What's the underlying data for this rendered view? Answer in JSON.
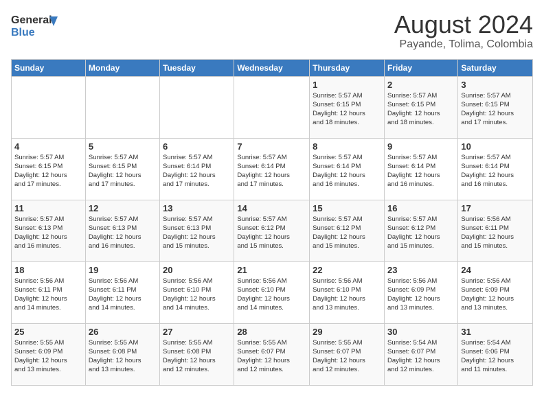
{
  "header": {
    "logo_line1": "General",
    "logo_line2": "Blue",
    "main_title": "August 2024",
    "subtitle": "Payande, Tolima, Colombia"
  },
  "days_of_week": [
    "Sunday",
    "Monday",
    "Tuesday",
    "Wednesday",
    "Thursday",
    "Friday",
    "Saturday"
  ],
  "weeks": [
    [
      {
        "day": "",
        "info": ""
      },
      {
        "day": "",
        "info": ""
      },
      {
        "day": "",
        "info": ""
      },
      {
        "day": "",
        "info": ""
      },
      {
        "day": "1",
        "info": "Sunrise: 5:57 AM\nSunset: 6:15 PM\nDaylight: 12 hours\nand 18 minutes."
      },
      {
        "day": "2",
        "info": "Sunrise: 5:57 AM\nSunset: 6:15 PM\nDaylight: 12 hours\nand 18 minutes."
      },
      {
        "day": "3",
        "info": "Sunrise: 5:57 AM\nSunset: 6:15 PM\nDaylight: 12 hours\nand 17 minutes."
      }
    ],
    [
      {
        "day": "4",
        "info": "Sunrise: 5:57 AM\nSunset: 6:15 PM\nDaylight: 12 hours\nand 17 minutes."
      },
      {
        "day": "5",
        "info": "Sunrise: 5:57 AM\nSunset: 6:15 PM\nDaylight: 12 hours\nand 17 minutes."
      },
      {
        "day": "6",
        "info": "Sunrise: 5:57 AM\nSunset: 6:14 PM\nDaylight: 12 hours\nand 17 minutes."
      },
      {
        "day": "7",
        "info": "Sunrise: 5:57 AM\nSunset: 6:14 PM\nDaylight: 12 hours\nand 17 minutes."
      },
      {
        "day": "8",
        "info": "Sunrise: 5:57 AM\nSunset: 6:14 PM\nDaylight: 12 hours\nand 16 minutes."
      },
      {
        "day": "9",
        "info": "Sunrise: 5:57 AM\nSunset: 6:14 PM\nDaylight: 12 hours\nand 16 minutes."
      },
      {
        "day": "10",
        "info": "Sunrise: 5:57 AM\nSunset: 6:14 PM\nDaylight: 12 hours\nand 16 minutes."
      }
    ],
    [
      {
        "day": "11",
        "info": "Sunrise: 5:57 AM\nSunset: 6:13 PM\nDaylight: 12 hours\nand 16 minutes."
      },
      {
        "day": "12",
        "info": "Sunrise: 5:57 AM\nSunset: 6:13 PM\nDaylight: 12 hours\nand 16 minutes."
      },
      {
        "day": "13",
        "info": "Sunrise: 5:57 AM\nSunset: 6:13 PM\nDaylight: 12 hours\nand 15 minutes."
      },
      {
        "day": "14",
        "info": "Sunrise: 5:57 AM\nSunset: 6:12 PM\nDaylight: 12 hours\nand 15 minutes."
      },
      {
        "day": "15",
        "info": "Sunrise: 5:57 AM\nSunset: 6:12 PM\nDaylight: 12 hours\nand 15 minutes."
      },
      {
        "day": "16",
        "info": "Sunrise: 5:57 AM\nSunset: 6:12 PM\nDaylight: 12 hours\nand 15 minutes."
      },
      {
        "day": "17",
        "info": "Sunrise: 5:56 AM\nSunset: 6:11 PM\nDaylight: 12 hours\nand 15 minutes."
      }
    ],
    [
      {
        "day": "18",
        "info": "Sunrise: 5:56 AM\nSunset: 6:11 PM\nDaylight: 12 hours\nand 14 minutes."
      },
      {
        "day": "19",
        "info": "Sunrise: 5:56 AM\nSunset: 6:11 PM\nDaylight: 12 hours\nand 14 minutes."
      },
      {
        "day": "20",
        "info": "Sunrise: 5:56 AM\nSunset: 6:10 PM\nDaylight: 12 hours\nand 14 minutes."
      },
      {
        "day": "21",
        "info": "Sunrise: 5:56 AM\nSunset: 6:10 PM\nDaylight: 12 hours\nand 14 minutes."
      },
      {
        "day": "22",
        "info": "Sunrise: 5:56 AM\nSunset: 6:10 PM\nDaylight: 12 hours\nand 13 minutes."
      },
      {
        "day": "23",
        "info": "Sunrise: 5:56 AM\nSunset: 6:09 PM\nDaylight: 12 hours\nand 13 minutes."
      },
      {
        "day": "24",
        "info": "Sunrise: 5:56 AM\nSunset: 6:09 PM\nDaylight: 12 hours\nand 13 minutes."
      }
    ],
    [
      {
        "day": "25",
        "info": "Sunrise: 5:55 AM\nSunset: 6:09 PM\nDaylight: 12 hours\nand 13 minutes."
      },
      {
        "day": "26",
        "info": "Sunrise: 5:55 AM\nSunset: 6:08 PM\nDaylight: 12 hours\nand 13 minutes."
      },
      {
        "day": "27",
        "info": "Sunrise: 5:55 AM\nSunset: 6:08 PM\nDaylight: 12 hours\nand 12 minutes."
      },
      {
        "day": "28",
        "info": "Sunrise: 5:55 AM\nSunset: 6:07 PM\nDaylight: 12 hours\nand 12 minutes."
      },
      {
        "day": "29",
        "info": "Sunrise: 5:55 AM\nSunset: 6:07 PM\nDaylight: 12 hours\nand 12 minutes."
      },
      {
        "day": "30",
        "info": "Sunrise: 5:54 AM\nSunset: 6:07 PM\nDaylight: 12 hours\nand 12 minutes."
      },
      {
        "day": "31",
        "info": "Sunrise: 5:54 AM\nSunset: 6:06 PM\nDaylight: 12 hours\nand 11 minutes."
      }
    ]
  ]
}
